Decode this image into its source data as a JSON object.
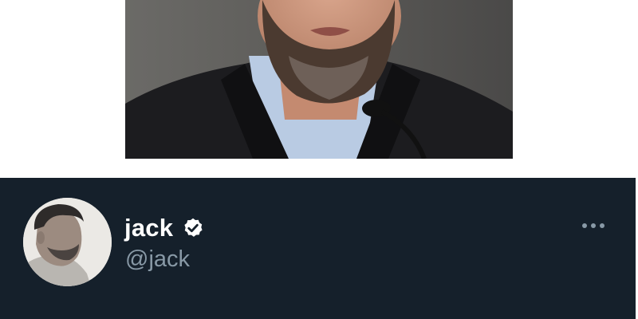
{
  "profile": {
    "display_name": "jack",
    "handle": "@jack",
    "verified": true
  },
  "icons": {
    "verified": "verified-badge-icon",
    "more": "more-options-icon"
  },
  "colors": {
    "panel_background": "#15202b",
    "name_text": "#ffffff",
    "handle_text": "#8899a6"
  }
}
